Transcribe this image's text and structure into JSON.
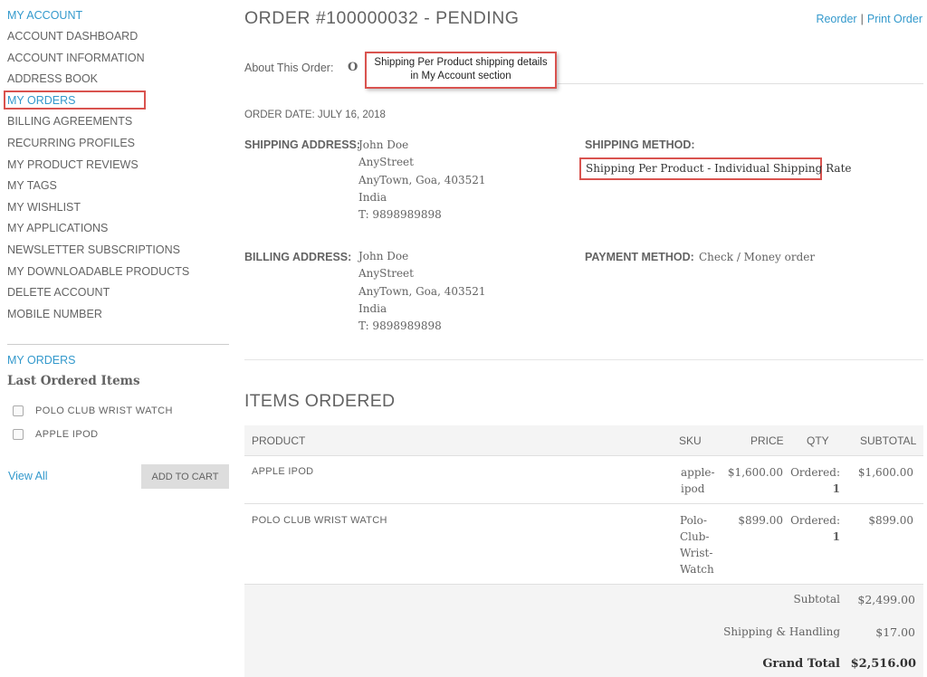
{
  "sidebar": {
    "account_title": "MY ACCOUNT",
    "items": [
      "ACCOUNT DASHBOARD",
      "ACCOUNT INFORMATION",
      "ADDRESS BOOK",
      "MY ORDERS",
      "BILLING AGREEMENTS",
      "RECURRING PROFILES",
      "MY PRODUCT REVIEWS",
      "MY TAGS",
      "MY WISHLIST",
      "MY APPLICATIONS",
      "NEWSLETTER SUBSCRIPTIONS",
      "MY DOWNLOADABLE PRODUCTS",
      "DELETE ACCOUNT",
      "MOBILE NUMBER"
    ],
    "active_item": "MY ORDERS",
    "orders_block": {
      "title": "MY ORDERS",
      "subtitle": "Last Ordered Items",
      "items": [
        "POLO CLUB WRIST WATCH",
        "APPLE IPOD"
      ],
      "view_all": "View All",
      "add_to_cart": "ADD TO CART"
    }
  },
  "order": {
    "title": "ORDER #100000032 - PENDING",
    "reorder": "Reorder",
    "separator": "|",
    "print": "Print Order",
    "about_label": "About This Order:",
    "about_tab_fragment": "O",
    "callout_line1": "Shipping Per Product shipping details",
    "callout_line2": "in My Account section",
    "order_date": "ORDER DATE: JULY 16, 2018",
    "shipping_address_label": "SHIPPING ADDRESS:",
    "shipping_address": [
      "John Doe",
      "AnyStreet",
      "AnyTown, Goa, 403521",
      "India",
      "T: 9898989898"
    ],
    "shipping_method_label": "SHIPPING METHOD:",
    "shipping_method": "Shipping Per Product - Individual Shipping Rate",
    "billing_address_label": "BILLING ADDRESS:",
    "billing_address": [
      "John Doe",
      "AnyStreet",
      "AnyTown, Goa, 403521",
      "India",
      "T: 9898989898"
    ],
    "payment_method_label": "PAYMENT METHOD:",
    "payment_method": "Check / Money order"
  },
  "items": {
    "title": "ITEMS ORDERED",
    "columns": {
      "product": "PRODUCT",
      "sku": "SKU",
      "price": "PRICE",
      "qty": "QTY",
      "subtotal": "SUBTOTAL"
    },
    "rows": [
      {
        "product": "APPLE IPOD",
        "sku": [
          "apple-",
          "ipod"
        ],
        "price": "$1,600.00",
        "qty_label": "Ordered:",
        "qty": "1",
        "subtotal": "$1,600.00"
      },
      {
        "product": "POLO CLUB WRIST WATCH",
        "sku": [
          "Polo-",
          "Club-",
          "Wrist-",
          "Watch"
        ],
        "price": "$899.00",
        "qty_label": "Ordered:",
        "qty": "1",
        "subtotal": "$899.00"
      }
    ],
    "totals": [
      {
        "label": "Subtotal",
        "value": "$2,499.00"
      },
      {
        "label": "Shipping & Handling",
        "value": "$17.00"
      },
      {
        "label": "Grand Total",
        "value": "$2,516.00"
      }
    ]
  },
  "colors": {
    "accent": "#3399cc",
    "highlight_border": "#d9534f",
    "text": "#636363"
  }
}
